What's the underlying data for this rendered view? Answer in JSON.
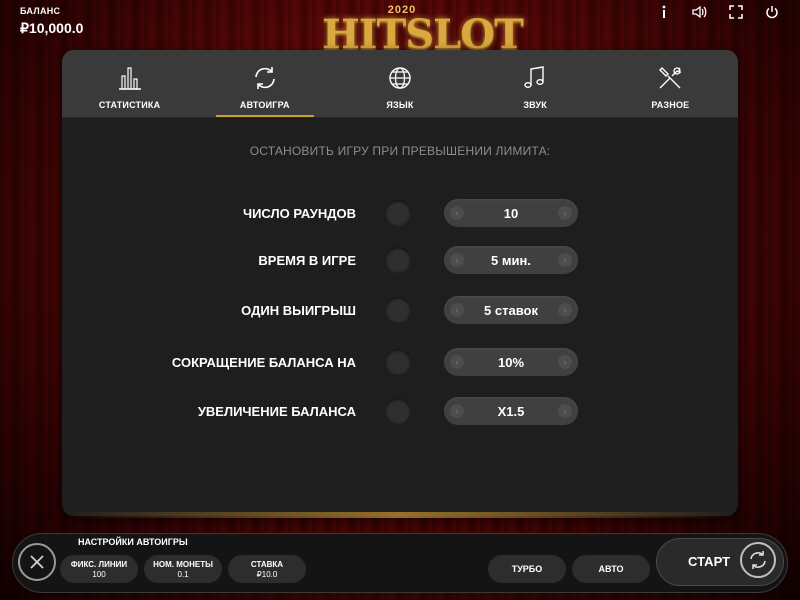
{
  "topbar": {
    "balance_label": "БАЛАНС",
    "balance_value": "₽10,000.0",
    "logo_year": "2020",
    "logo_text": "HITSLOT",
    "icons": [
      "info-icon",
      "sound-icon",
      "fullscreen-icon",
      "power-icon"
    ]
  },
  "tabs": [
    {
      "label": "СТАТИСТИКА",
      "icon": "bar-chart-icon",
      "active": false
    },
    {
      "label": "АВТОИГРА",
      "icon": "refresh-icon",
      "active": true
    },
    {
      "label": "ЯЗЫК",
      "icon": "globe-icon",
      "active": false
    },
    {
      "label": "ЗВУК",
      "icon": "music-note-icon",
      "active": false
    },
    {
      "label": "РАЗНОЕ",
      "icon": "tools-icon",
      "active": false
    }
  ],
  "autoplay": {
    "heading": "ОСТАНОВИТЬ ИГРУ ПРИ ПРЕВЫШЕНИИ ЛИМИТА:",
    "rows": [
      {
        "label": "ЧИСЛО РАУНДОВ",
        "value": "10",
        "enabled": false
      },
      {
        "label": "ВРЕМЯ В ИГРЕ",
        "value": "5 мин.",
        "enabled": false
      },
      {
        "label": "ОДИН ВЫИГРЫШ",
        "value": "5 ставок",
        "enabled": false
      },
      {
        "label": "СОКРАЩЕНИЕ БАЛАНСА НА",
        "value": "10%",
        "enabled": false
      },
      {
        "label": "УВЕЛИЧЕНИЕ БАЛАНСА",
        "value": "X1.5",
        "enabled": false
      }
    ]
  },
  "bottombar": {
    "autoplay_settings_label": "НАСТРОЙКИ АВТОИГРЫ",
    "fixed_lines_label": "ФИКС. ЛИНИИ",
    "fixed_lines_value": "100",
    "coin_value_label": "НОМ. МОНЕТЫ",
    "coin_value_value": "0.1",
    "bet_label": "СТАВКА",
    "bet_value": "₽10.0",
    "turbo_label": "ТУРБО",
    "auto_label": "АВТО",
    "start_label": "СТАРТ"
  },
  "colors": {
    "accent_gold": "#c9a02e",
    "panel_bg": "#1e1e1e",
    "tabs_bg": "#3a3a3a",
    "curtain_red": "#8e0f0f"
  }
}
